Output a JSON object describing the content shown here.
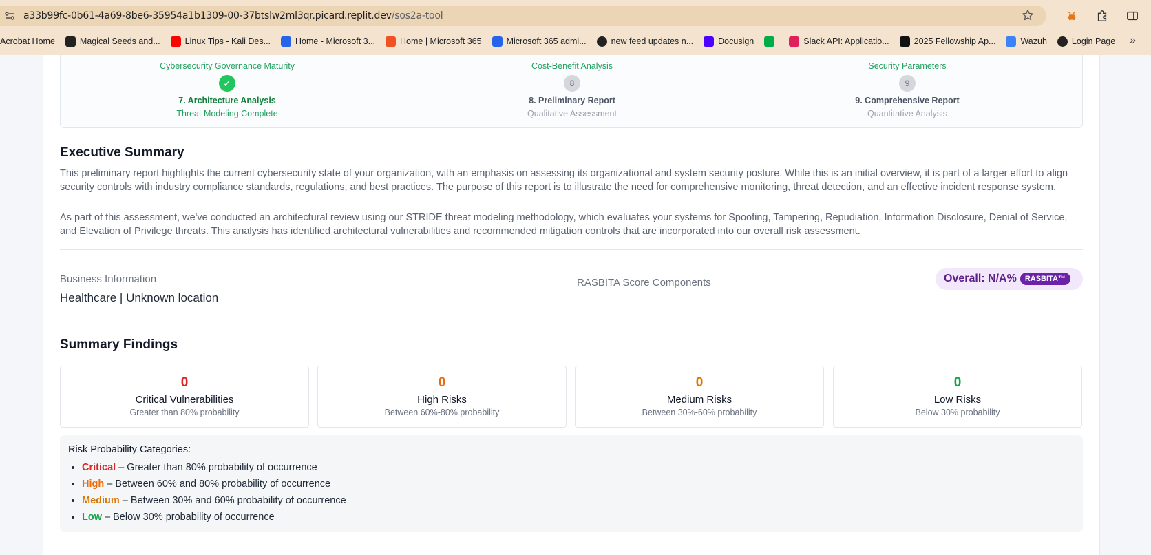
{
  "browser": {
    "url_host": "a33b99fc-0b61-4a69-8be6-35954a1b1309-00-37btslw2ml3qr.picard.replit.dev",
    "url_path": "/sos2a-tool",
    "bookmarks": [
      {
        "label": "Acrobat Home",
        "icon": "acrobat-icon",
        "color": ""
      },
      {
        "label": "Magical Seeds and...",
        "icon": "seeds-icon",
        "color": "#222222"
      },
      {
        "label": "Linux Tips - Kali Des...",
        "icon": "youtube-icon",
        "color": "#ff0000"
      },
      {
        "label": "Home - Microsoft 3...",
        "icon": "microsoft-icon",
        "color": "#2563eb"
      },
      {
        "label": "Home | Microsoft 365",
        "icon": "microsoft365-icon",
        "color": "#f25022"
      },
      {
        "label": "Microsoft 365 admi...",
        "icon": "admin-icon",
        "color": "#2563eb"
      },
      {
        "label": "new feed updates n...",
        "icon": "globe-icon",
        "color": "#222222"
      },
      {
        "label": "Docusign",
        "icon": "docusign-icon",
        "color": "#4c00ff"
      },
      {
        "label": "",
        "icon": "meet-icon",
        "color": "#00ac47"
      },
      {
        "label": "Slack API: Applicatio...",
        "icon": "slack-icon",
        "color": "#e01e5a"
      },
      {
        "label": "2025 Fellowship Ap...",
        "icon": "fellowship-icon",
        "color": "#111111"
      },
      {
        "label": "Wazuh",
        "icon": "wazuh-icon",
        "color": "#3b82f6"
      },
      {
        "label": "Login Page",
        "icon": "globe-icon",
        "color": "#222222"
      }
    ]
  },
  "stepper": {
    "top_row": [
      "Cybersecurity Governance Maturity",
      "Cost-Benefit Analysis",
      "Security Parameters"
    ],
    "steps": [
      {
        "num": "✓",
        "title": "7. Architecture Analysis",
        "sub": "Threat Modeling Complete",
        "state": "done"
      },
      {
        "num": "8",
        "title": "8. Preliminary Report",
        "sub": "Qualitative Assessment",
        "state": "todo"
      },
      {
        "num": "9",
        "title": "9. Comprehensive Report",
        "sub": "Quantitative Analysis",
        "state": "todo"
      }
    ]
  },
  "executive_summary": {
    "heading": "Executive Summary",
    "p1": "This preliminary report highlights the current cybersecurity state of your organization, with an emphasis on assessing its organizational and system security posture. While this is an initial overview, it is part of a larger effort to align security controls with industry compliance standards, regulations, and best practices. The purpose of this report is to illustrate the need for comprehensive monitoring, threat detection, and an effective incident response system.",
    "p2": "As part of this assessment, we've conducted an architectural review using our STRIDE threat modeling methodology, which evaluates your systems for Spoofing, Tampering, Repudiation, Information Disclosure, Denial of Service, and Elevation of Privilege threats. This analysis has identified architectural vulnerabilities and recommended mitigation controls that are incorporated into our overall risk assessment."
  },
  "business": {
    "label": "Business Information",
    "value": "Healthcare | Unknown location",
    "rasbita_label": "RASBITA Score Components",
    "overall": "Overall: N/A%",
    "badge": "RASBITA™"
  },
  "summary_findings": {
    "heading": "Summary Findings",
    "cards": [
      {
        "count": "0",
        "title": "Critical Vulnerabilities",
        "sub": "Greater than 80% probability",
        "color": "#dc2626"
      },
      {
        "count": "0",
        "title": "High Risks",
        "sub": "Between 60%-80% probability",
        "color": "#ea6a0c"
      },
      {
        "count": "0",
        "title": "Medium Risks",
        "sub": "Between 30%-60% probability",
        "color": "#d97706"
      },
      {
        "count": "0",
        "title": "Low Risks",
        "sub": "Below 30% probability",
        "color": "#16a34a"
      }
    ]
  },
  "categories": {
    "title": "Risk Probability Categories:",
    "items": [
      {
        "level": "Critical",
        "text": " – Greater than 80% probability of occurrence",
        "color": "#dc2626"
      },
      {
        "level": "High",
        "text": " – Between 60% and 80% probability of occurrence",
        "color": "#ea6a0c"
      },
      {
        "level": "Medium",
        "text": " – Between 30% and 60% probability of occurrence",
        "color": "#d97706"
      },
      {
        "level": "Low",
        "text": " – Below 30% probability of occurrence",
        "color": "#16a34a"
      }
    ]
  }
}
